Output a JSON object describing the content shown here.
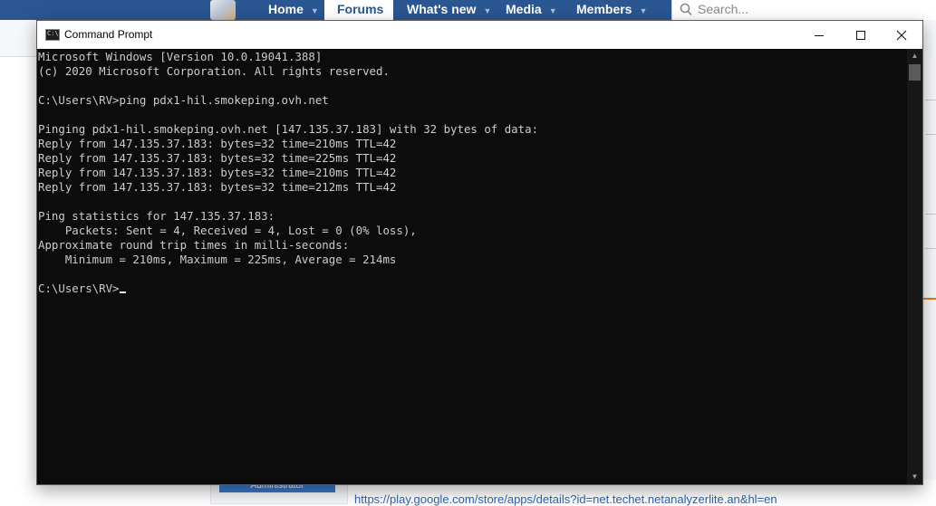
{
  "nav": {
    "items": [
      {
        "label": "Home"
      },
      {
        "label": "Forums"
      },
      {
        "label": "What's new"
      },
      {
        "label": "Media"
      },
      {
        "label": "Members"
      }
    ],
    "search_placeholder": "Search..."
  },
  "background": {
    "badge": "Administrator",
    "link": "https://play.google.com/store/apps/details?id=net.techet.netanalyzerlite.an&hl=en"
  },
  "window": {
    "title": "Command Prompt",
    "icon_label": "C:\\",
    "buttons": {
      "minimize": "—",
      "maximize": "☐",
      "close": "✕"
    }
  },
  "terminal": {
    "lines": [
      "Microsoft Windows [Version 10.0.19041.388]",
      "(c) 2020 Microsoft Corporation. All rights reserved.",
      "",
      "C:\\Users\\RV>ping pdx1-hil.smokeping.ovh.net",
      "",
      "Pinging pdx1-hil.smokeping.ovh.net [147.135.37.183] with 32 bytes of data:",
      "Reply from 147.135.37.183: bytes=32 time=210ms TTL=42",
      "Reply from 147.135.37.183: bytes=32 time=225ms TTL=42",
      "Reply from 147.135.37.183: bytes=32 time=210ms TTL=42",
      "Reply from 147.135.37.183: bytes=32 time=212ms TTL=42",
      "",
      "Ping statistics for 147.135.37.183:",
      "    Packets: Sent = 4, Received = 4, Lost = 0 (0% loss),",
      "Approximate round trip times in milli-seconds:",
      "    Minimum = 210ms, Maximum = 225ms, Average = 214ms",
      ""
    ],
    "prompt": "C:\\Users\\RV>"
  },
  "colors": {
    "nav_bg": "#2a5692",
    "terminal_bg": "#0c0c0c",
    "terminal_fg": "#cccccc"
  }
}
